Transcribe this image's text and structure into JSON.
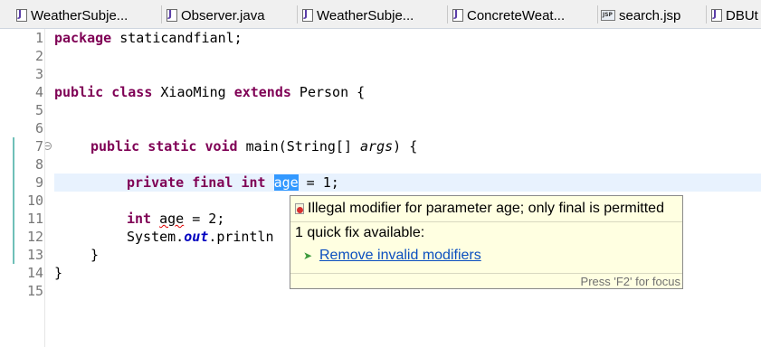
{
  "tabs": [
    {
      "label": "WeatherSubje...",
      "icon": "java-file-icon"
    },
    {
      "label": "Observer.java",
      "icon": "java-file-icon"
    },
    {
      "label": "WeatherSubje...",
      "icon": "java-file-icon"
    },
    {
      "label": "ConcreteWeat...",
      "icon": "java-file-icon"
    },
    {
      "label": "search.jsp",
      "icon": "jsp-file-icon"
    },
    {
      "label": "DBUt",
      "icon": "java-file-icon"
    }
  ],
  "editor": {
    "line_numbers": [
      "1",
      "2",
      "3",
      "4",
      "5",
      "6",
      "7",
      "8",
      "9",
      "10",
      "11",
      "12",
      "13",
      "14",
      "15"
    ],
    "code": {
      "l1_kw": "package",
      "l1_rest": " staticandfianl;",
      "l4_kw1": "public",
      "l4_kw2": "class",
      "l4_name": " XiaoMing ",
      "l4_kw3": "extends",
      "l4_rest": " Person {",
      "l7_kw1": "public",
      "l7_kw2": "static",
      "l7_kw3": "void",
      "l7_mid": " main(String[] ",
      "l7_param": "args",
      "l7_end": ") {",
      "l9_kw1": "private",
      "l9_kw2": "final",
      "l9_kw3": "int",
      "l9_var": "age",
      "l9_rest": " = 1;",
      "l11_kw": "int",
      "l11_var": "age",
      "l11_rest": " = 2;",
      "l12_a": "System.",
      "l12_field": "out",
      "l12_b": ".println",
      "l13": "}",
      "l14": "}"
    }
  },
  "popup": {
    "message": "Illegal modifier for parameter age; only final is permitted",
    "quick_fix_count": "1 quick fix available:",
    "fix_label": "Remove invalid modifiers",
    "footer": "Press 'F2' for focus"
  },
  "colors": {
    "keyword": "#7f0055",
    "selection": "#3399ff",
    "current_line": "#e8f2fe",
    "popup_bg": "#ffffe1",
    "link": "#0b4fbf"
  }
}
